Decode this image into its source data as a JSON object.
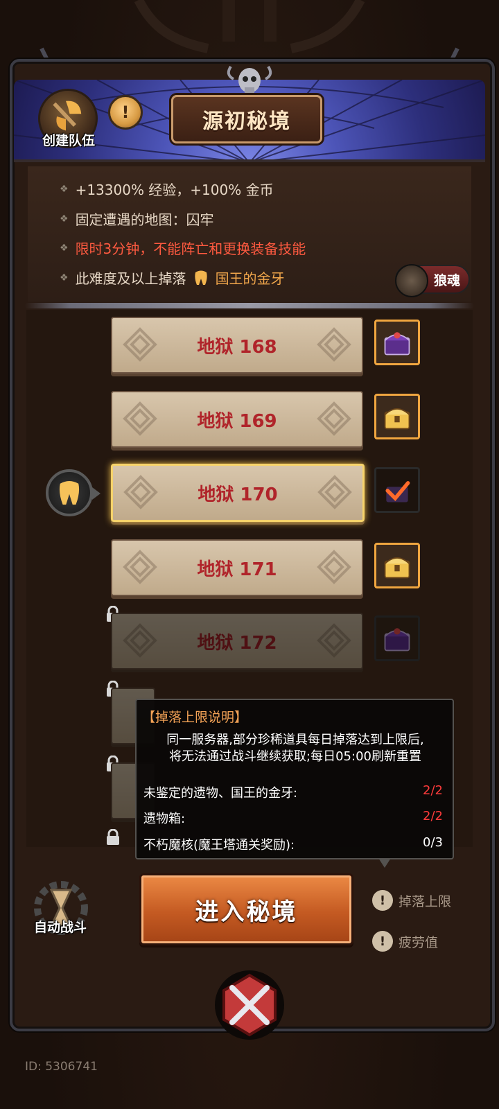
{
  "header": {
    "title": "源初秘境",
    "create_team_label": "创建队伍",
    "info_symbol": "!"
  },
  "info": {
    "lines": [
      "+13300% 经验，+100% 金币",
      "固定遭遇的地图：囚牢",
      "限时3分钟，不能阵亡和更换装备技能"
    ],
    "drop_prefix": "此难度及以上掉落",
    "drop_item": "国王的金牙",
    "wolf_button": "狼魂"
  },
  "levels": [
    {
      "label": "地狱 168",
      "state": "normal",
      "chest": "purple"
    },
    {
      "label": "地狱 169",
      "state": "normal",
      "chest": "gold"
    },
    {
      "label": "地狱 170",
      "state": "selected",
      "chest": "checked"
    },
    {
      "label": "地狱 171",
      "state": "normal",
      "chest": "gold"
    },
    {
      "label": "地狱 172",
      "state": "locked",
      "chest": "purple"
    }
  ],
  "tooltip": {
    "title": "【掉落上限说明】",
    "desc_line1": "同一服务器,部分珍稀道具每日掉落达到上限后,",
    "desc_line2": "将无法通过战斗继续获取;每日05:00刷新重置",
    "rows": [
      {
        "label": "未鉴定的遗物、国王的金牙:",
        "value": "2/2",
        "highlight": true
      },
      {
        "label": "遗物箱:",
        "value": "2/2",
        "highlight": true
      },
      {
        "label": "不朽魔核(魔王塔通关奖励):",
        "value": "0/3",
        "highlight": false
      }
    ]
  },
  "bottom": {
    "auto_battle_label": "自动战斗",
    "enter_button": "进入秘境",
    "drop_limit_link": "掉落上限",
    "fatigue_link": "疲劳值",
    "id_text": "ID: 5306741"
  },
  "colors": {
    "accent_orange": "#c45a22",
    "warning_red": "#ff5a40",
    "gold": "#f0a64b",
    "level_text": "#b0242a"
  }
}
